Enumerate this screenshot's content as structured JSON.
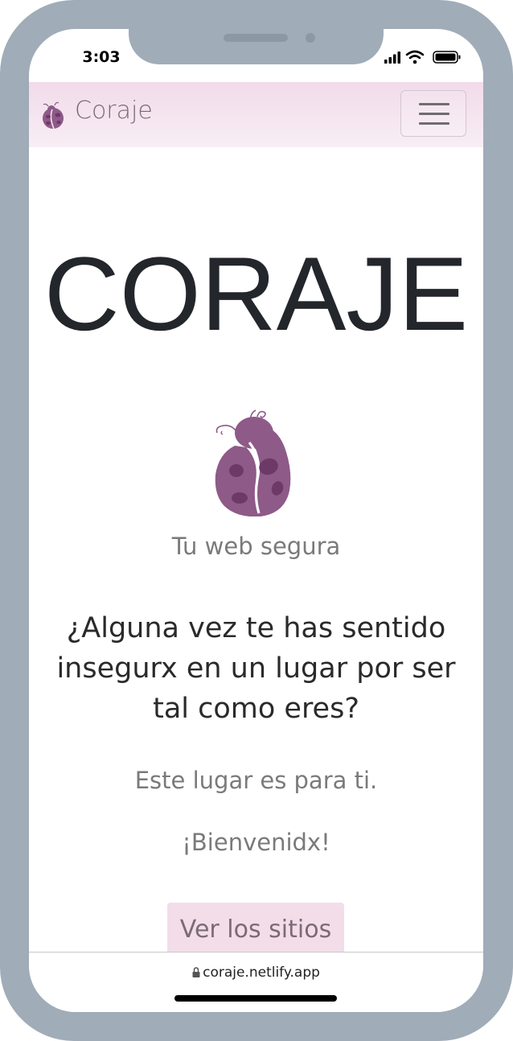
{
  "status_bar": {
    "time": "3:03",
    "icons": [
      "cellular-signal-icon",
      "wifi-icon",
      "battery-icon"
    ]
  },
  "navbar": {
    "brand": "Coraje",
    "brand_icon": "ladybug-icon",
    "toggle_icon": "hamburger-menu-icon"
  },
  "hero": {
    "title": "CORAJE",
    "logo_icon": "ladybug-logo-icon",
    "tagline": "Tu web segura",
    "question_lines": [
      "¿Alguna vez te has sentido",
      "insegurx en un lugar por ser",
      "tal como eres?"
    ],
    "paragraph_1": "Este lugar es para ti.",
    "paragraph_2": "¡Bienvenidx!",
    "cta_label": "Ver los sitios"
  },
  "browser": {
    "url": "coraje.netlify.app",
    "lock_icon": "lock-icon"
  },
  "colors": {
    "brand": "#7b6a78",
    "logo": "#8e5a88",
    "navbar_bg": "#f1dbea",
    "cta_bg": "#f3dde9",
    "frame": "#a0acb8"
  }
}
